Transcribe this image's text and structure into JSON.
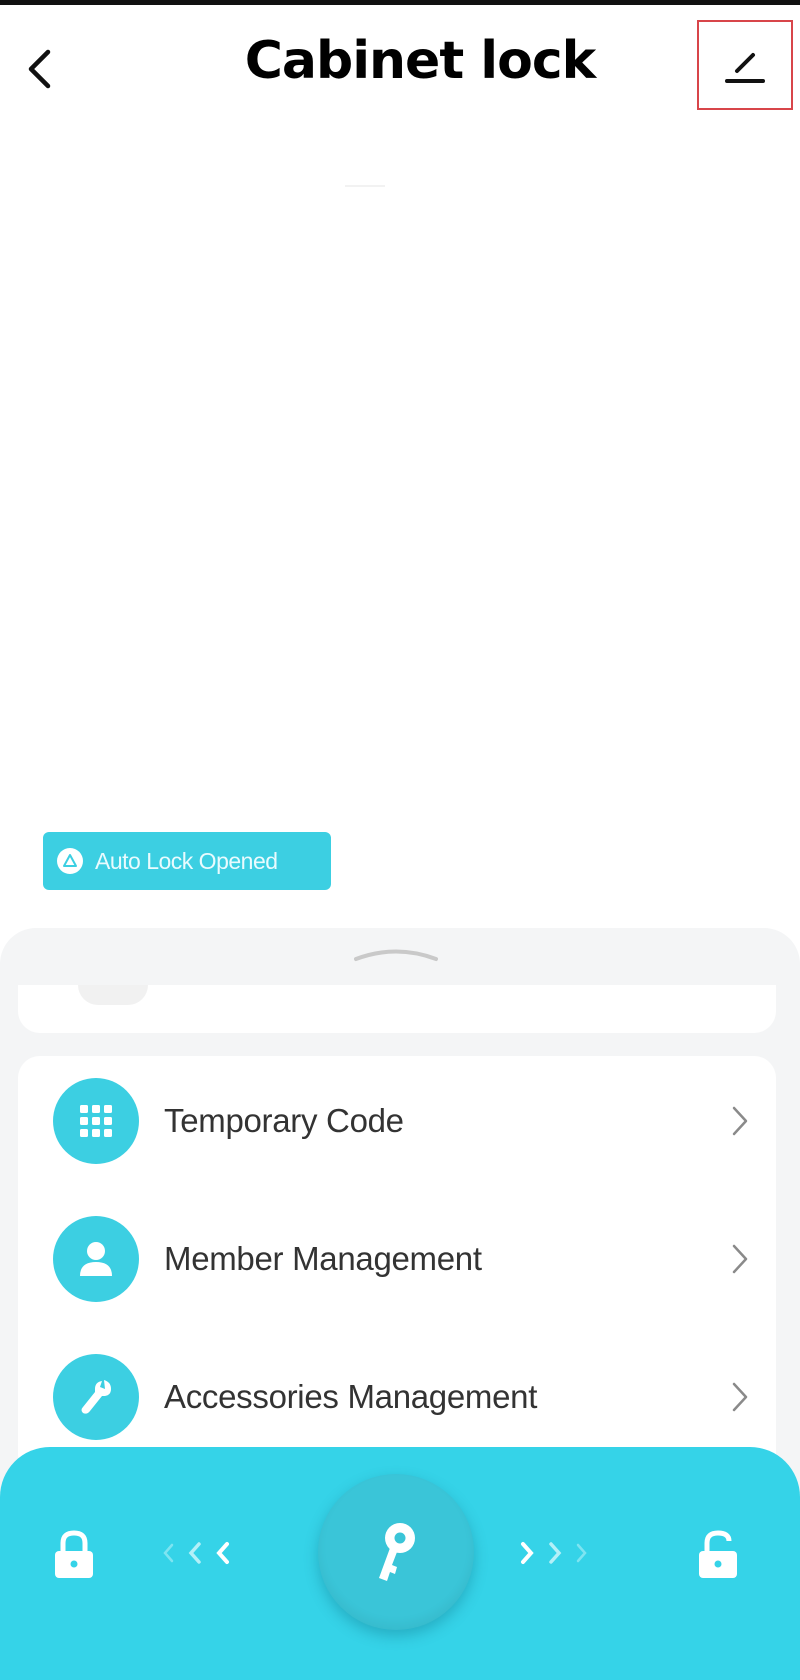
{
  "header": {
    "title": "Cabinet lock",
    "back_icon": "chevron-left-icon",
    "edit_icon": "pencil-icon"
  },
  "status": {
    "auto_lock_label": "Auto Lock Opened",
    "icon": "alert-triangle-icon"
  },
  "menu": {
    "items": [
      {
        "label": "Temporary Code",
        "icon": "keypad-icon"
      },
      {
        "label": "Member Management",
        "icon": "person-icon"
      },
      {
        "label": "Accessories Management",
        "icon": "wrench-icon"
      }
    ]
  },
  "bottom_bar": {
    "lock_icon": "lock-closed-icon",
    "unlock_icon": "lock-open-icon",
    "center_icon": "key-icon"
  },
  "colors": {
    "accent": "#3ccfe2",
    "bar": "#35d3e8",
    "highlight_border": "#d8454a"
  }
}
